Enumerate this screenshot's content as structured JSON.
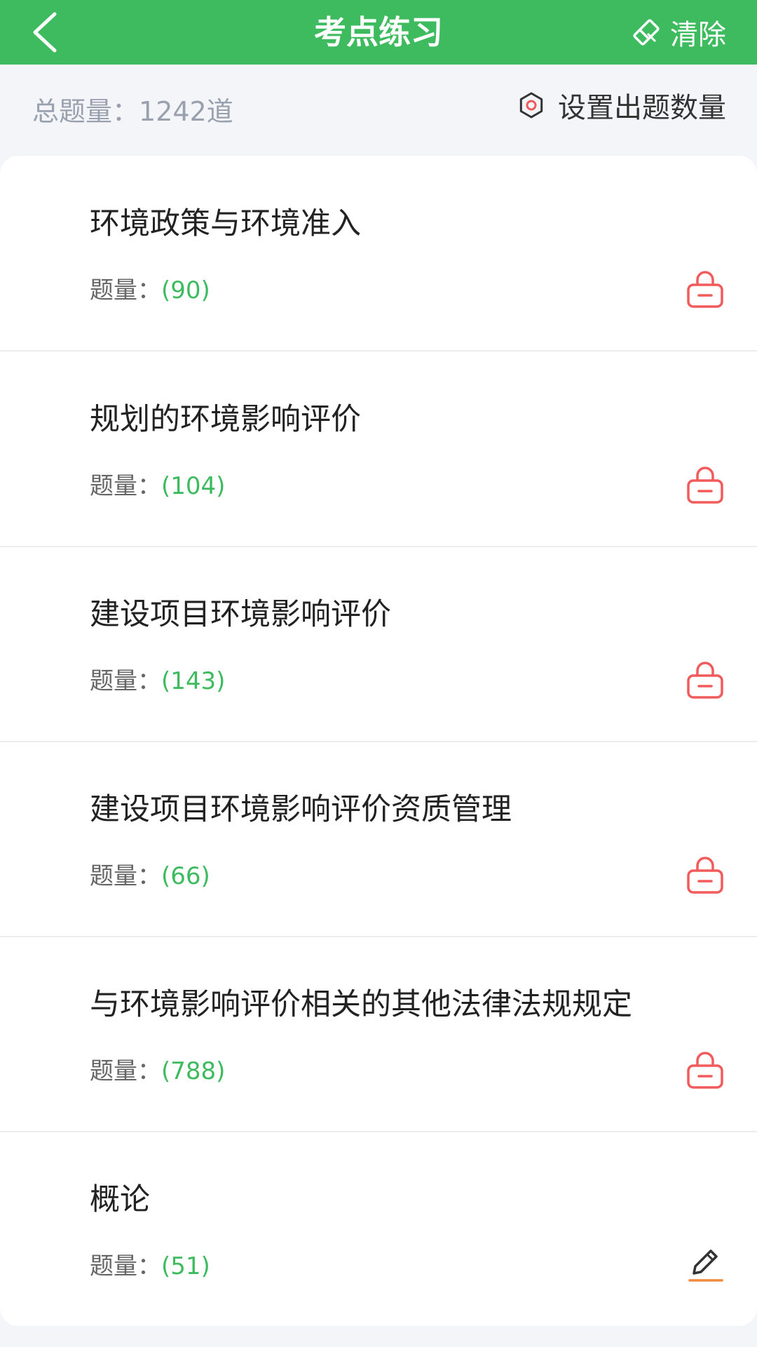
{
  "header": {
    "title": "考点练习",
    "clear_label": "清除"
  },
  "summary": {
    "total_label": "总题量：",
    "total_value": "1242道",
    "settings_label": "设置出题数量"
  },
  "list": {
    "count_prefix": "题量：",
    "items": [
      {
        "title": "环境政策与环境准入",
        "count": "(90)",
        "icon": "lock-icon"
      },
      {
        "title": "规划的环境影响评价",
        "count": "(104)",
        "icon": "lock-icon"
      },
      {
        "title": "建设项目环境影响评价",
        "count": "(143)",
        "icon": "lock-icon"
      },
      {
        "title": "建设项目环境影响评价资质管理",
        "count": "(66)",
        "icon": "lock-icon"
      },
      {
        "title": "与环境影响评价相关的其他法律法规规定",
        "count": "(788)",
        "icon": "lock-icon"
      },
      {
        "title": "概论",
        "count": "(51)",
        "icon": "pencil-icon"
      }
    ]
  },
  "colors": {
    "brand_green": "#3dbb5e",
    "lock_red": "#f25b5b",
    "pencil_underline": "#f08a3c"
  }
}
